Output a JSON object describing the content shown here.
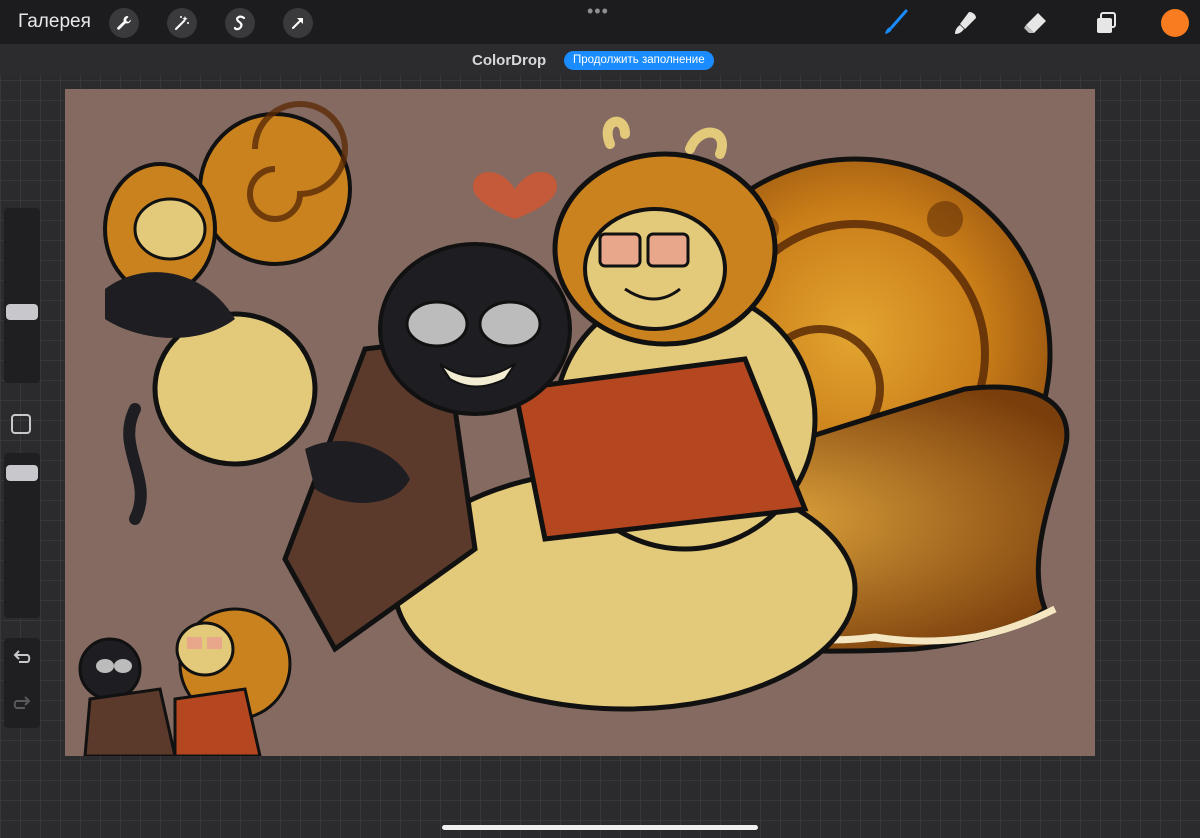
{
  "topbar": {
    "gallery_label": "Галерея",
    "left_tools": [
      "wrench-icon",
      "magic-wand-icon",
      "selection-s-icon",
      "arrow-icon"
    ],
    "right_tools": [
      "brush-icon",
      "smudge-icon",
      "eraser-icon",
      "layers-icon"
    ],
    "active_tool": "brush-icon",
    "active_color": "#f97d20",
    "accent_color": "#1a8cff"
  },
  "infobar": {
    "title": "ColorDrop",
    "button_label": "Продолжить заполнение"
  },
  "canvas": {
    "background_color": "#846a61"
  },
  "sidebar": {
    "brush_size_level": 0.55,
    "opacity_level": 0.92,
    "modifier_icon": "square-modifier-icon",
    "undo_icon": "undo-icon",
    "redo_icon": "redo-icon"
  }
}
